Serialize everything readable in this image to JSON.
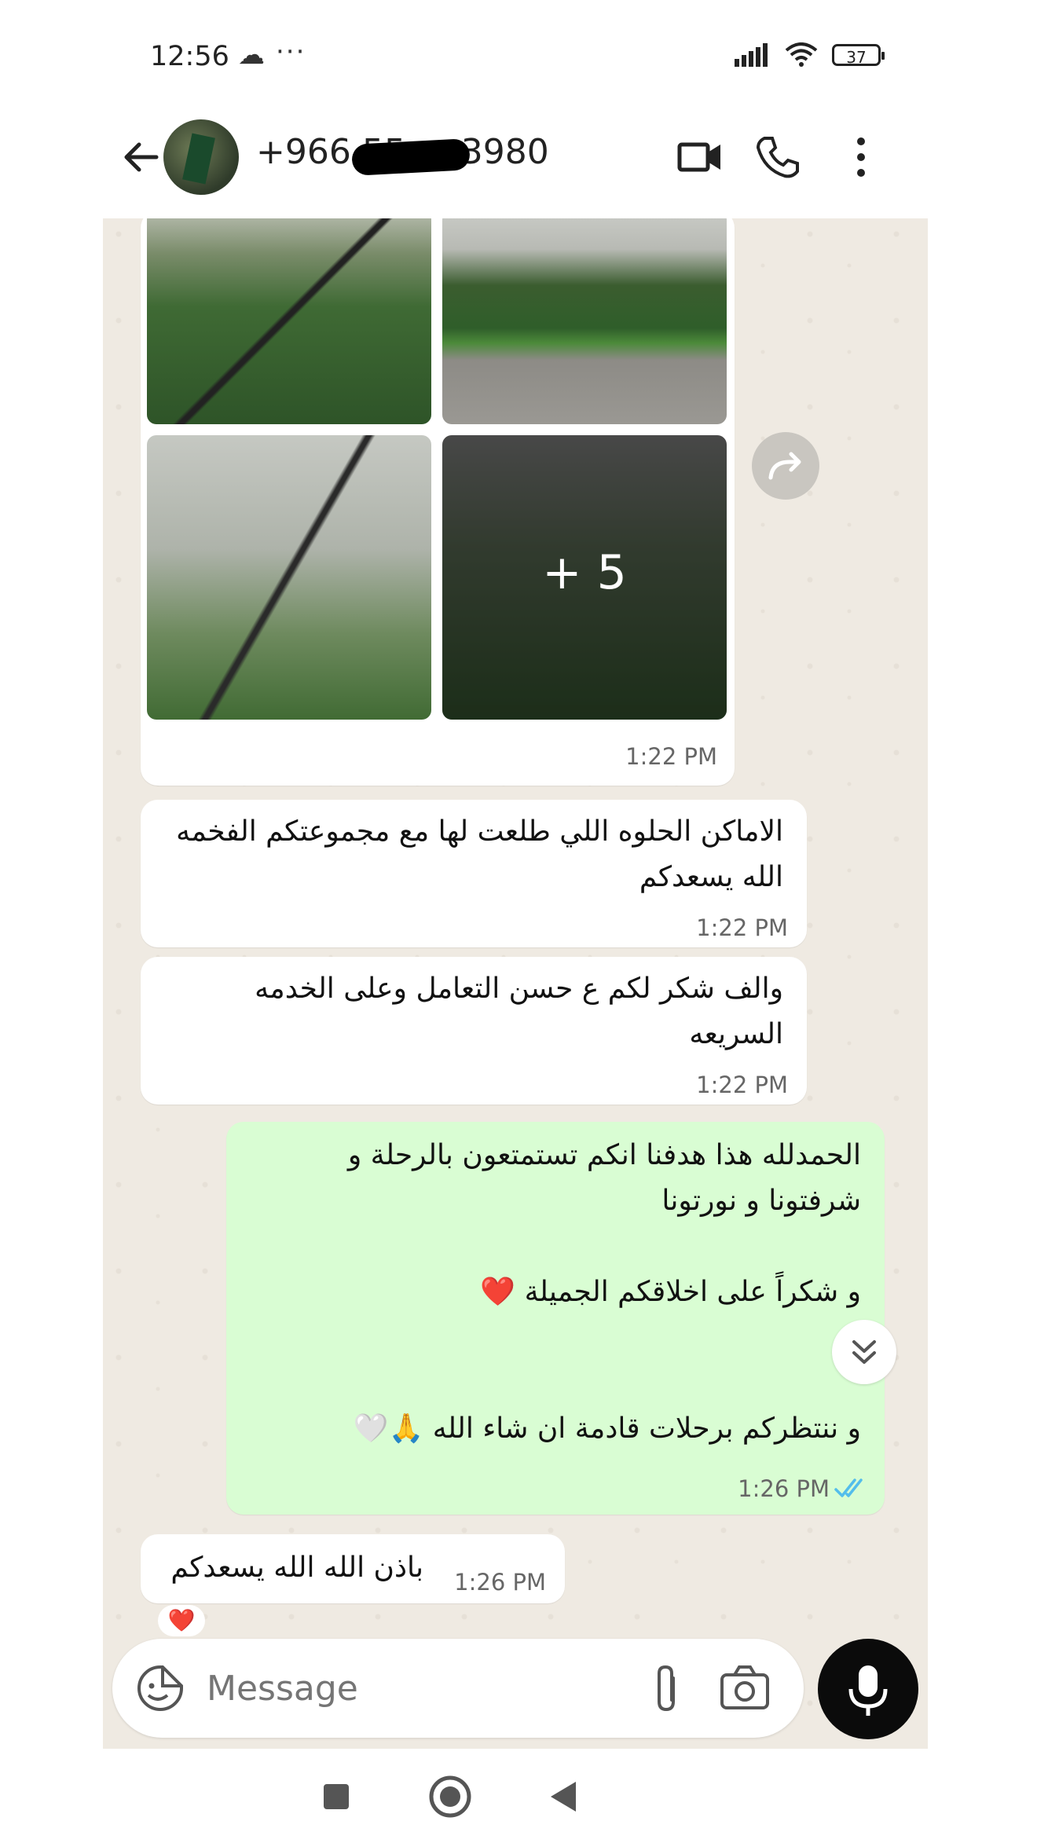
{
  "status_bar": {
    "time": "12:56",
    "battery": "37"
  },
  "header": {
    "contact": "+966 55 ··· 3980"
  },
  "messages": [
    {
      "type": "image-grid",
      "direction": "incoming",
      "more_count": "+ 5",
      "time": "1:22 PM"
    },
    {
      "type": "text",
      "direction": "incoming",
      "lines": [
        "الاماكن الحلوه اللي طلعت لها مع مجموعتكم الفخمه",
        "الله يسعدكم"
      ],
      "time": "1:22 PM"
    },
    {
      "type": "text",
      "direction": "incoming",
      "lines": [
        "والف شكر لكم ع حسن التعامل وعلى الخدمه",
        "السريعه"
      ],
      "time": "1:22 PM"
    },
    {
      "type": "text",
      "direction": "outgoing",
      "lines": [
        "الحمدلله هذا هدفنا انكم تستمتعون بالرحلة و",
        "شرفتونا و نورتونا",
        "",
        "و شكراً على اخلاقكم الجميلة ❤️",
        "",
        "",
        "و ننتظركم برحلات قادمة ان شاء الله 🙏🤍"
      ],
      "time": "1:26 PM",
      "read": true
    },
    {
      "type": "text",
      "direction": "incoming",
      "lines": [
        "باذن الله الله يسعدكم"
      ],
      "time": "1:26 PM",
      "reaction": "❤️"
    }
  ],
  "composer": {
    "placeholder": "Message"
  },
  "colors": {
    "chat_bg": "#efeae2",
    "outgoing_bubble": "#d9fdd3",
    "read_tick": "#53bdeb"
  }
}
